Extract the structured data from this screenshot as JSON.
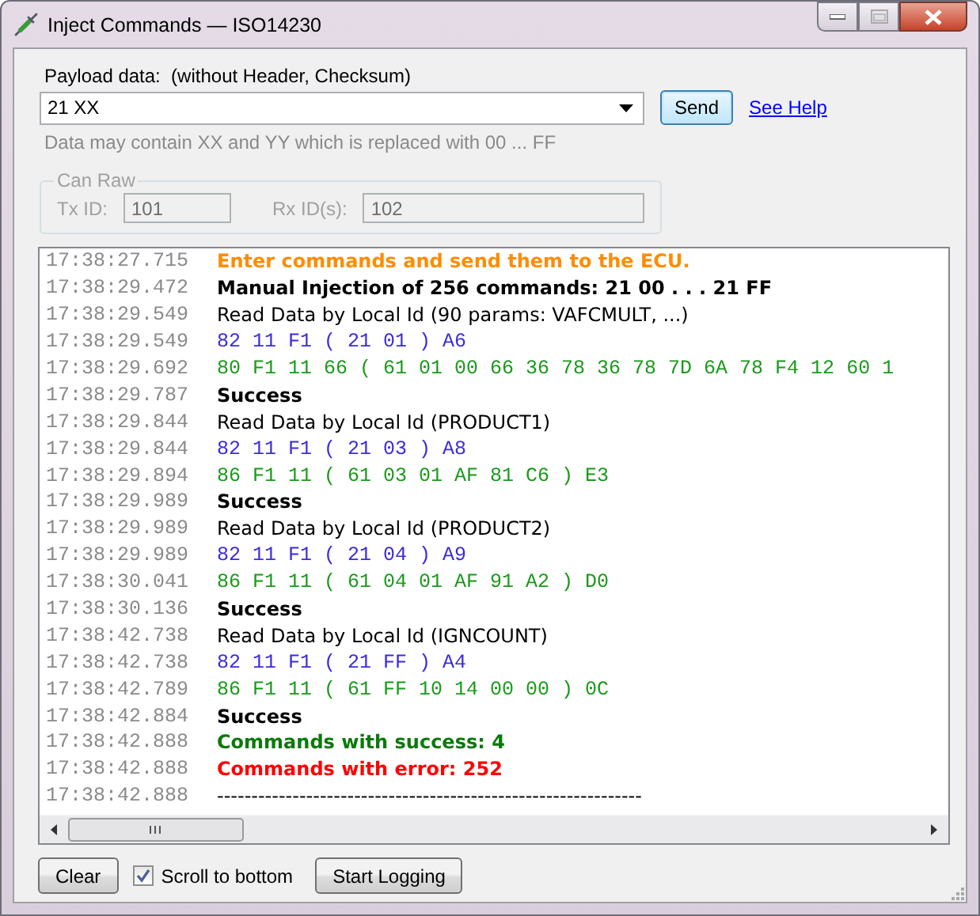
{
  "window": {
    "title": "Inject Commands — ISO14230"
  },
  "payload": {
    "label": "Payload data:  (without Header, Checksum)",
    "value": "21 XX",
    "hint": "Data may contain XX and YY which is replaced with 00 ... FF"
  },
  "send_button": "Send",
  "help_link": "See Help",
  "can_raw": {
    "title": "Can Raw",
    "disabled": true,
    "tx_label": "Tx ID:",
    "tx_value": "101",
    "rx_label": "Rx ID(s):",
    "rx_value": "102"
  },
  "log": [
    {
      "time": "17:38:27.715",
      "kind": "info",
      "text": "Enter commands and send them to the ECU."
    },
    {
      "time": "17:38:29.472",
      "kind": "header",
      "text": "Manual Injection of 256 commands: 21 00 . . . 21 FF"
    },
    {
      "time": "17:38:29.549",
      "kind": "text",
      "text": "Read Data by Local Id (90 params: VAFCMULT, ...)"
    },
    {
      "time": "17:38:29.549",
      "kind": "request",
      "text": "82 11 F1 ( 21 01 ) A6"
    },
    {
      "time": "17:38:29.692",
      "kind": "response",
      "text": "80 F1 11 66 ( 61 01 00 66 36 78 36 78 7D 6A 78 F4 12 60 1"
    },
    {
      "time": "17:38:29.787",
      "kind": "header",
      "text": "Success"
    },
    {
      "time": "17:38:29.844",
      "kind": "text",
      "text": "Read Data by Local Id (PRODUCT1)"
    },
    {
      "time": "17:38:29.844",
      "kind": "request",
      "text": "82 11 F1 ( 21 03 ) A8"
    },
    {
      "time": "17:38:29.894",
      "kind": "response",
      "text": "86 F1 11 ( 61 03 01 AF 81 C6 ) E3"
    },
    {
      "time": "17:38:29.989",
      "kind": "header",
      "text": "Success"
    },
    {
      "time": "17:38:29.989",
      "kind": "text",
      "text": "Read Data by Local Id (PRODUCT2)"
    },
    {
      "time": "17:38:29.989",
      "kind": "request",
      "text": "82 11 F1 ( 21 04 ) A9"
    },
    {
      "time": "17:38:30.041",
      "kind": "response",
      "text": "86 F1 11 ( 61 04 01 AF 91 A2 ) D0"
    },
    {
      "time": "17:38:30.136",
      "kind": "header",
      "text": "Success"
    },
    {
      "time": "17:38:42.738",
      "kind": "text",
      "text": "Read Data by Local Id (IGNCOUNT)"
    },
    {
      "time": "17:38:42.738",
      "kind": "request",
      "text": "82 11 F1 ( 21 FF ) A4"
    },
    {
      "time": "17:38:42.789",
      "kind": "response",
      "text": "86 F1 11 ( 61 FF 10 14 00 00 ) 0C"
    },
    {
      "time": "17:38:42.884",
      "kind": "header",
      "text": "Success"
    },
    {
      "time": "17:38:42.888",
      "kind": "ok",
      "text": "Commands with success: 4"
    },
    {
      "time": "17:38:42.888",
      "kind": "error",
      "text": "Commands with error: 252"
    },
    {
      "time": "17:38:42.888",
      "kind": "text",
      "text": "--------------------------------------------------------------"
    }
  ],
  "footer": {
    "clear_button": "Clear",
    "scroll_checkbox": {
      "label": "Scroll to bottom",
      "checked": true
    },
    "logging_button": "Start Logging"
  }
}
